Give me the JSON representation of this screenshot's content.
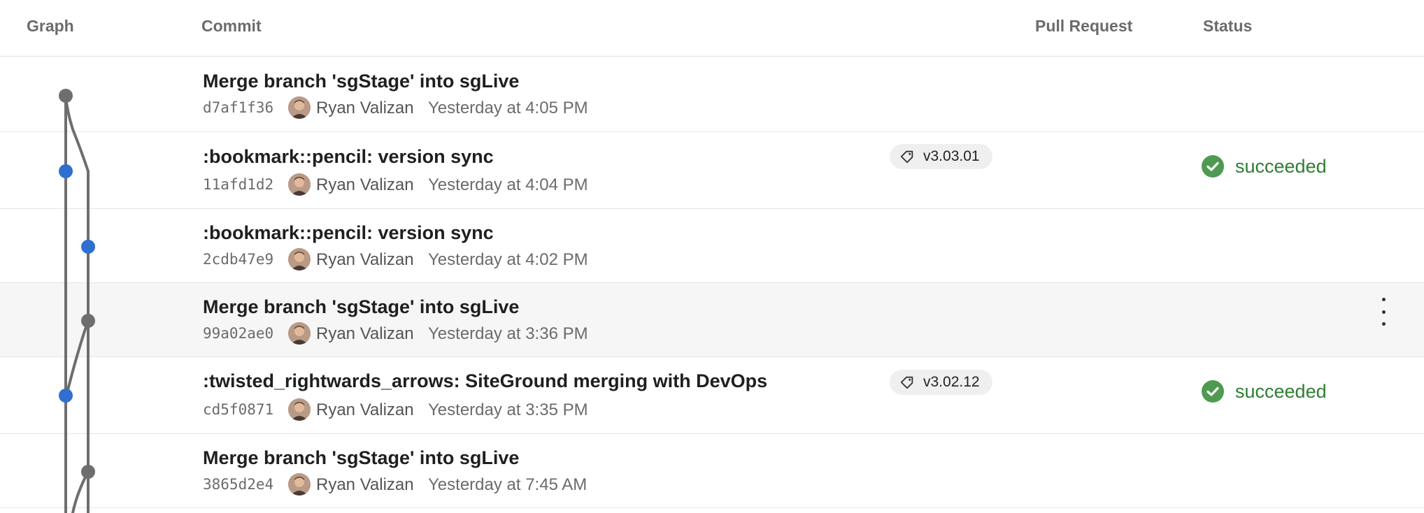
{
  "columns": {
    "graph": "Graph",
    "commit": "Commit",
    "pull_request": "Pull Request",
    "status": "Status"
  },
  "commits": [
    {
      "message": "Merge branch 'sgStage' into sgLive",
      "hash": "d7af1f36",
      "author": "Ryan Valizan",
      "date": "Yesterday at 4:05 PM",
      "tag": "",
      "status": ""
    },
    {
      "message": ":bookmark::pencil: version sync",
      "hash": "11afd1d2",
      "author": "Ryan Valizan",
      "date": "Yesterday at 4:04 PM",
      "tag": "v3.03.01",
      "status": "succeeded"
    },
    {
      "message": ":bookmark::pencil: version sync",
      "hash": "2cdb47e9",
      "author": "Ryan Valizan",
      "date": "Yesterday at 4:02 PM",
      "tag": "",
      "status": ""
    },
    {
      "message": "Merge branch 'sgStage' into sgLive",
      "hash": "99a02ae0",
      "author": "Ryan Valizan",
      "date": "Yesterday at 3:36 PM",
      "tag": "",
      "status": ""
    },
    {
      "message": ":twisted_rightwards_arrows: SiteGround merging with DevOps",
      "hash": "cd5f0871",
      "author": "Ryan Valizan",
      "date": "Yesterday at 3:35 PM",
      "tag": "v3.02.12",
      "status": "succeeded"
    },
    {
      "message": "Merge branch 'sgStage' into sgLive",
      "hash": "3865d2e4",
      "author": "Ryan Valizan",
      "date": "Yesterday at 7:45 AM",
      "tag": "",
      "status": ""
    }
  ],
  "icons": {
    "tag": "tag-icon",
    "status_success": "check-circle-icon",
    "more": "more-vertical-icon"
  },
  "colors": {
    "commit_blue": "#2f6fd1",
    "merge_gray": "#6e6e6e",
    "success_green": "#2e7d32"
  }
}
